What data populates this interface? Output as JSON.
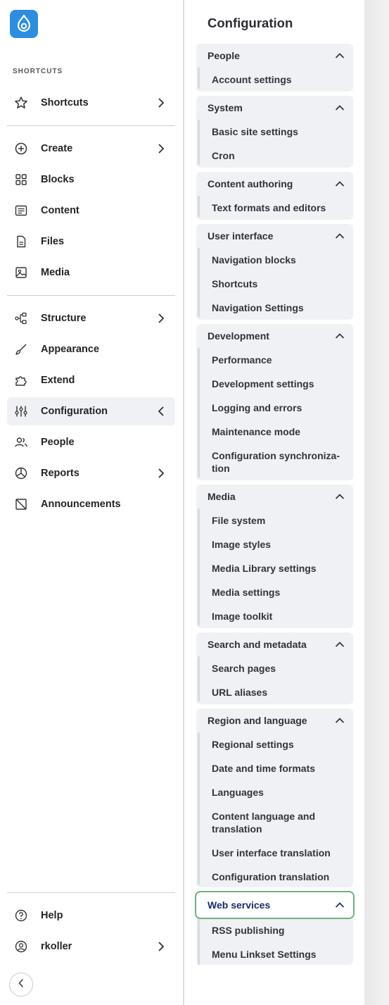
{
  "sidebar": {
    "section_label": "SHORTCUTS",
    "items": [
      {
        "label": "Shortcuts",
        "icon": "star-icon"
      },
      {
        "label": "Create",
        "icon": "plus-circle-icon"
      },
      {
        "label": "Blocks",
        "icon": "blocks-icon"
      },
      {
        "label": "Content",
        "icon": "content-icon"
      },
      {
        "label": "Files",
        "icon": "file-icon"
      },
      {
        "label": "Media",
        "icon": "image-icon"
      },
      {
        "label": "Structure",
        "icon": "structure-icon"
      },
      {
        "label": "Appearance",
        "icon": "brush-icon"
      },
      {
        "label": "Extend",
        "icon": "puzzle-icon"
      },
      {
        "label": "Configuration",
        "icon": "sliders-icon"
      },
      {
        "label": "People",
        "icon": "people-icon"
      },
      {
        "label": "Reports",
        "icon": "chart-icon"
      },
      {
        "label": "Announcements",
        "icon": "announcement-icon"
      }
    ],
    "footer": [
      {
        "label": "Help",
        "icon": "help-icon"
      },
      {
        "label": "rkoller",
        "icon": "user-icon"
      }
    ]
  },
  "panel": {
    "title": "Configuration",
    "groups": [
      {
        "label": "People",
        "items": [
          "Account settings"
        ]
      },
      {
        "label": "System",
        "items": [
          "Basic site settings",
          "Cron"
        ]
      },
      {
        "label": "Content authoring",
        "items": [
          "Text formats and editors"
        ]
      },
      {
        "label": "User interface",
        "items": [
          "Navigation blocks",
          "Shortcuts",
          "Navigation Settings"
        ]
      },
      {
        "label": "Development",
        "items": [
          "Performance",
          "Development settings",
          "Logging and errors",
          "Maintenance mode",
          "Configuration synchroniza-tion"
        ]
      },
      {
        "label": "Media",
        "items": [
          "File system",
          "Image styles",
          "Media Library settings",
          "Media settings",
          "Image toolkit"
        ]
      },
      {
        "label": "Search and metadata",
        "items": [
          "Search pages",
          "URL aliases"
        ]
      },
      {
        "label": "Region and language",
        "items": [
          "Regional settings",
          "Date and time formats",
          "Languages",
          "Content language and translation",
          "User interface translation",
          "Configuration translation"
        ]
      },
      {
        "label": "Web services",
        "items": [
          "RSS publishing",
          "Menu Linkset Settings"
        ]
      }
    ]
  },
  "colors": {
    "accent": "#2d8de0",
    "focus": "#6bb37c",
    "group_bg": "#f0f1f5"
  }
}
